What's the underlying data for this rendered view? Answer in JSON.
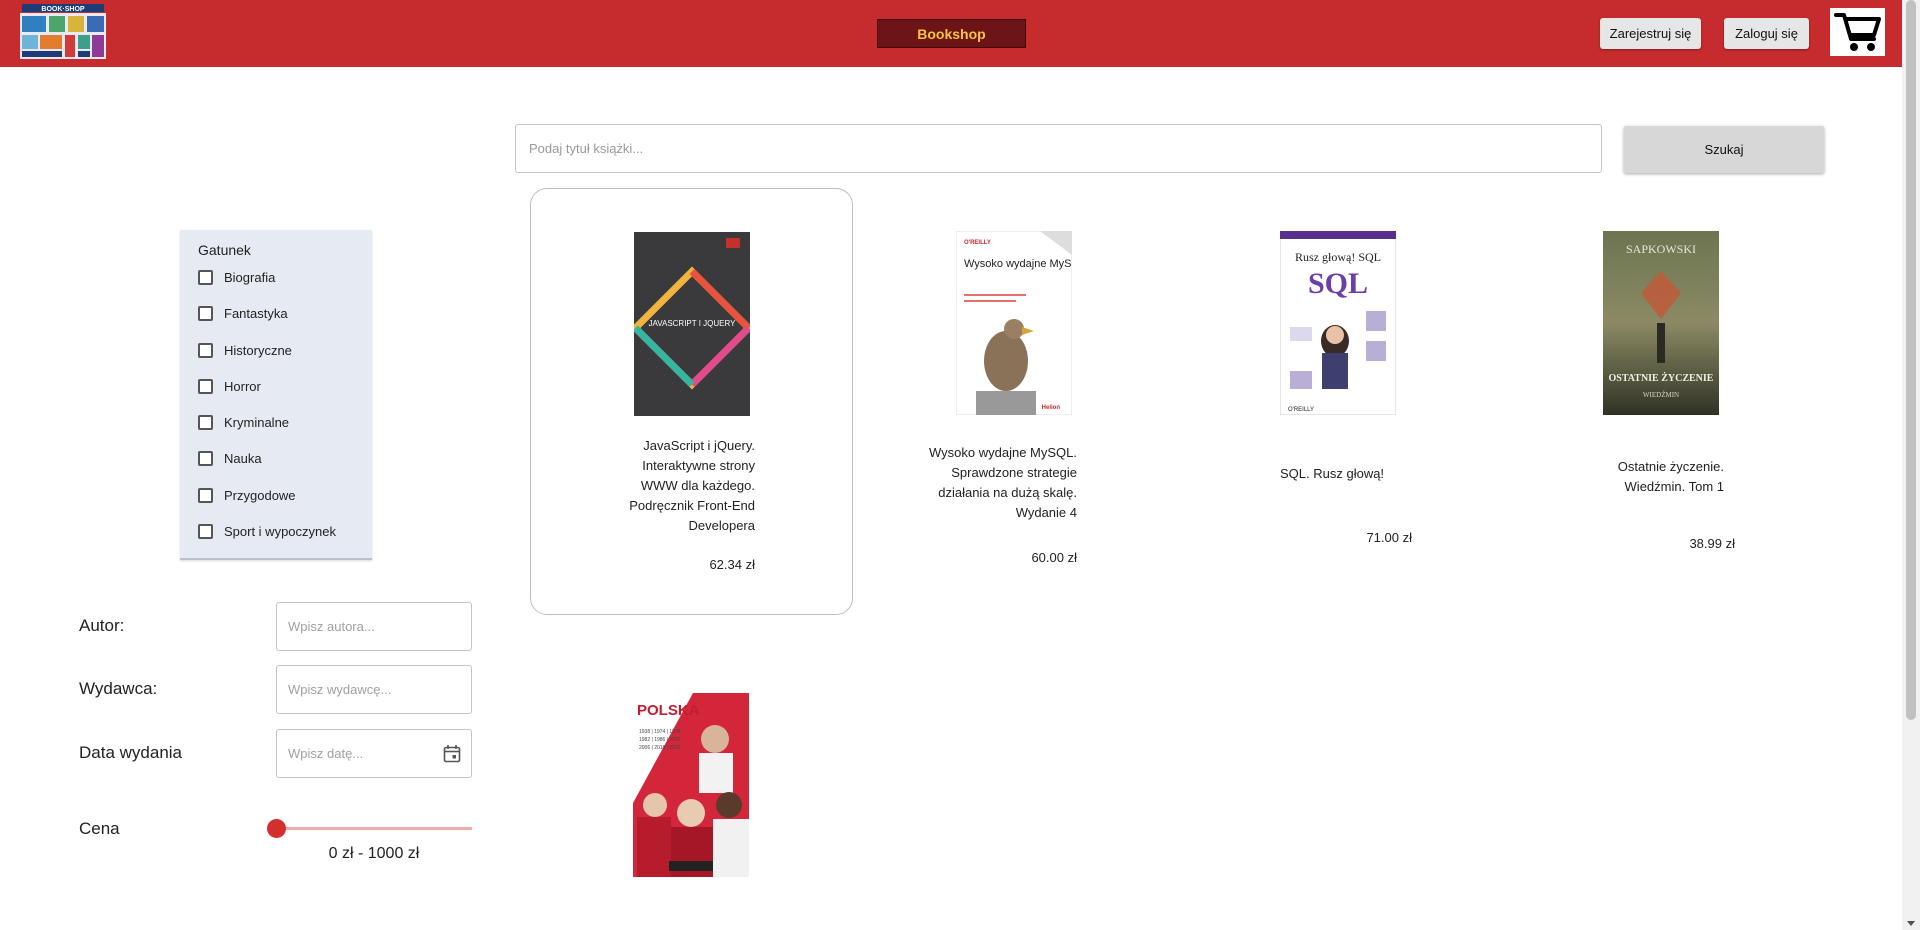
{
  "header": {
    "brand": "Bookshop",
    "register_label": "Zarejestruj się",
    "login_label": "Zaloguj się",
    "logo_text": "BOOK·SHOP"
  },
  "search": {
    "placeholder": "Podaj tytuł książki...",
    "button_label": "Szukaj"
  },
  "genres": {
    "title": "Gatunek",
    "items": [
      "Biografia",
      "Fantastyka",
      "Historyczne",
      "Horror",
      "Kryminalne",
      "Nauka",
      "Przygodowe",
      "Sport i wypoczynek"
    ]
  },
  "filters": {
    "author_label": "Autor:",
    "author_placeholder": "Wpisz autora...",
    "publisher_label": "Wydawca:",
    "publisher_placeholder": "Wpisz wydawcę...",
    "date_label": "Data wydania",
    "date_placeholder": "Wpisz datę...",
    "price_label": "Cena",
    "price_range": "0 zł - 1000 zł"
  },
  "books": [
    {
      "title_lines": [
        "JavaScript i jQuery.",
        "Interaktywne strony",
        "WWW dla każdego.",
        "Podręcznik Front-End",
        "Developera"
      ],
      "price": "62.34 zł",
      "cover_text": "JAVASCRIPT I JQUERY"
    },
    {
      "title_lines": [
        "Wysoko wydajne MySQL.",
        "Sprawdzone strategie",
        "działania na dużą skalę.",
        "Wydanie 4"
      ],
      "price": "60.00 zł",
      "cover_text": "Wysoko wydajne MySQL"
    },
    {
      "title_lines": [
        "SQL. Rusz głową!"
      ],
      "price": "71.00 zł",
      "cover_text": "Rusz głową! SQL"
    },
    {
      "title_lines": [
        "Ostatnie życzenie.",
        "Wiedźmin. Tom 1"
      ],
      "price": "38.99 zł",
      "cover_text": "OSTATNIE ŻYCZENIE"
    },
    {
      "title_lines": [],
      "price": "",
      "cover_text": "POLSKA"
    }
  ],
  "colors": {
    "header_bg": "#c62b2e",
    "brand_bg": "#6d1416",
    "brand_text": "#f5c242",
    "slider_accent": "#d32f2f"
  }
}
